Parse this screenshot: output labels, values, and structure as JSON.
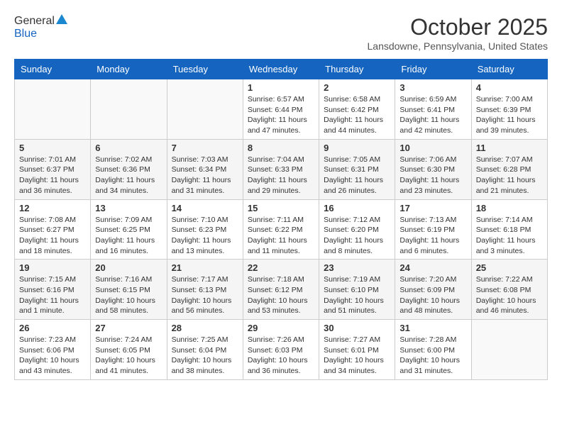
{
  "header": {
    "logo_line1": "General",
    "logo_line2": "Blue",
    "month": "October 2025",
    "location": "Lansdowne, Pennsylvania, United States"
  },
  "days_of_week": [
    "Sunday",
    "Monday",
    "Tuesday",
    "Wednesday",
    "Thursday",
    "Friday",
    "Saturday"
  ],
  "weeks": [
    [
      {
        "day": "",
        "info": ""
      },
      {
        "day": "",
        "info": ""
      },
      {
        "day": "",
        "info": ""
      },
      {
        "day": "1",
        "info": "Sunrise: 6:57 AM\nSunset: 6:44 PM\nDaylight: 11 hours\nand 47 minutes."
      },
      {
        "day": "2",
        "info": "Sunrise: 6:58 AM\nSunset: 6:42 PM\nDaylight: 11 hours\nand 44 minutes."
      },
      {
        "day": "3",
        "info": "Sunrise: 6:59 AM\nSunset: 6:41 PM\nDaylight: 11 hours\nand 42 minutes."
      },
      {
        "day": "4",
        "info": "Sunrise: 7:00 AM\nSunset: 6:39 PM\nDaylight: 11 hours\nand 39 minutes."
      }
    ],
    [
      {
        "day": "5",
        "info": "Sunrise: 7:01 AM\nSunset: 6:37 PM\nDaylight: 11 hours\nand 36 minutes."
      },
      {
        "day": "6",
        "info": "Sunrise: 7:02 AM\nSunset: 6:36 PM\nDaylight: 11 hours\nand 34 minutes."
      },
      {
        "day": "7",
        "info": "Sunrise: 7:03 AM\nSunset: 6:34 PM\nDaylight: 11 hours\nand 31 minutes."
      },
      {
        "day": "8",
        "info": "Sunrise: 7:04 AM\nSunset: 6:33 PM\nDaylight: 11 hours\nand 29 minutes."
      },
      {
        "day": "9",
        "info": "Sunrise: 7:05 AM\nSunset: 6:31 PM\nDaylight: 11 hours\nand 26 minutes."
      },
      {
        "day": "10",
        "info": "Sunrise: 7:06 AM\nSunset: 6:30 PM\nDaylight: 11 hours\nand 23 minutes."
      },
      {
        "day": "11",
        "info": "Sunrise: 7:07 AM\nSunset: 6:28 PM\nDaylight: 11 hours\nand 21 minutes."
      }
    ],
    [
      {
        "day": "12",
        "info": "Sunrise: 7:08 AM\nSunset: 6:27 PM\nDaylight: 11 hours\nand 18 minutes."
      },
      {
        "day": "13",
        "info": "Sunrise: 7:09 AM\nSunset: 6:25 PM\nDaylight: 11 hours\nand 16 minutes."
      },
      {
        "day": "14",
        "info": "Sunrise: 7:10 AM\nSunset: 6:23 PM\nDaylight: 11 hours\nand 13 minutes."
      },
      {
        "day": "15",
        "info": "Sunrise: 7:11 AM\nSunset: 6:22 PM\nDaylight: 11 hours\nand 11 minutes."
      },
      {
        "day": "16",
        "info": "Sunrise: 7:12 AM\nSunset: 6:20 PM\nDaylight: 11 hours\nand 8 minutes."
      },
      {
        "day": "17",
        "info": "Sunrise: 7:13 AM\nSunset: 6:19 PM\nDaylight: 11 hours\nand 6 minutes."
      },
      {
        "day": "18",
        "info": "Sunrise: 7:14 AM\nSunset: 6:18 PM\nDaylight: 11 hours\nand 3 minutes."
      }
    ],
    [
      {
        "day": "19",
        "info": "Sunrise: 7:15 AM\nSunset: 6:16 PM\nDaylight: 11 hours\nand 1 minute."
      },
      {
        "day": "20",
        "info": "Sunrise: 7:16 AM\nSunset: 6:15 PM\nDaylight: 10 hours\nand 58 minutes."
      },
      {
        "day": "21",
        "info": "Sunrise: 7:17 AM\nSunset: 6:13 PM\nDaylight: 10 hours\nand 56 minutes."
      },
      {
        "day": "22",
        "info": "Sunrise: 7:18 AM\nSunset: 6:12 PM\nDaylight: 10 hours\nand 53 minutes."
      },
      {
        "day": "23",
        "info": "Sunrise: 7:19 AM\nSunset: 6:10 PM\nDaylight: 10 hours\nand 51 minutes."
      },
      {
        "day": "24",
        "info": "Sunrise: 7:20 AM\nSunset: 6:09 PM\nDaylight: 10 hours\nand 48 minutes."
      },
      {
        "day": "25",
        "info": "Sunrise: 7:22 AM\nSunset: 6:08 PM\nDaylight: 10 hours\nand 46 minutes."
      }
    ],
    [
      {
        "day": "26",
        "info": "Sunrise: 7:23 AM\nSunset: 6:06 PM\nDaylight: 10 hours\nand 43 minutes."
      },
      {
        "day": "27",
        "info": "Sunrise: 7:24 AM\nSunset: 6:05 PM\nDaylight: 10 hours\nand 41 minutes."
      },
      {
        "day": "28",
        "info": "Sunrise: 7:25 AM\nSunset: 6:04 PM\nDaylight: 10 hours\nand 38 minutes."
      },
      {
        "day": "29",
        "info": "Sunrise: 7:26 AM\nSunset: 6:03 PM\nDaylight: 10 hours\nand 36 minutes."
      },
      {
        "day": "30",
        "info": "Sunrise: 7:27 AM\nSunset: 6:01 PM\nDaylight: 10 hours\nand 34 minutes."
      },
      {
        "day": "31",
        "info": "Sunrise: 7:28 AM\nSunset: 6:00 PM\nDaylight: 10 hours\nand 31 minutes."
      },
      {
        "day": "",
        "info": ""
      }
    ]
  ]
}
